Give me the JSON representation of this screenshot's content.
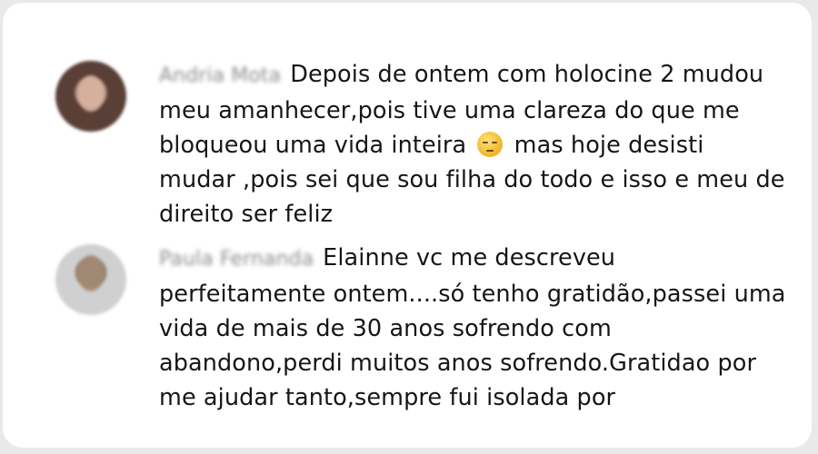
{
  "comments": [
    {
      "author": "Andria Mota",
      "text_before_emoji": "Depois de ontem com holocine 2 mudou meu amanhecer,pois tive uma clareza do que me bloqueou uma vida inteira",
      "emoji": "pensive-face",
      "text_after_emoji": "mas hoje desisti mudar ,pois sei que sou filha do todo e isso e meu de direito ser feliz"
    },
    {
      "author": "Paula Fernanda",
      "text": "Elainne vc me descreveu perfeitamente ontem....só tenho gratidão,passei uma vida de mais de 30 anos sofrendo com abandono,perdi muitos anos sofrendo.Gratidao por me ajudar tanto,sempre fui isolada por"
    }
  ]
}
